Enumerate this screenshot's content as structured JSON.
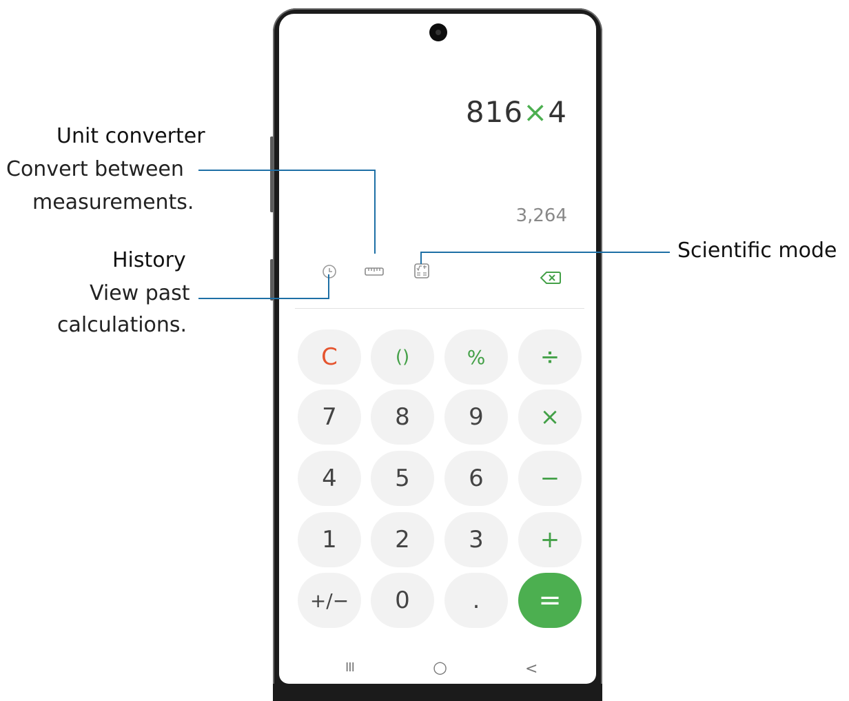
{
  "annotations": {
    "unit_converter": {
      "title": "Unit converter",
      "desc1": "Convert between",
      "desc2": "measurements."
    },
    "history": {
      "title": "History",
      "desc1": "View past",
      "desc2": "calculations."
    },
    "scientific": {
      "title": "Scientific mode"
    }
  },
  "calculator": {
    "expression_left": "816",
    "expression_op": "×",
    "expression_right": "4",
    "result": "3,264",
    "keys": {
      "row1": [
        "C",
        "()",
        "%",
        "÷"
      ],
      "row2": [
        "7",
        "8",
        "9",
        "×"
      ],
      "row3": [
        "4",
        "5",
        "6",
        "−"
      ],
      "row4": [
        "1",
        "2",
        "3",
        "+"
      ],
      "row5": [
        "+/−",
        "0",
        ".",
        "="
      ]
    },
    "nav": {
      "recents": "III",
      "home": "○",
      "back": "<"
    }
  },
  "colors": {
    "accent_green": "#4caf50",
    "clear_red": "#e5542e",
    "leader_blue": "#1d6fa5"
  },
  "icons": [
    "history-icon",
    "ruler-icon",
    "scientific-icon",
    "backspace-icon"
  ]
}
